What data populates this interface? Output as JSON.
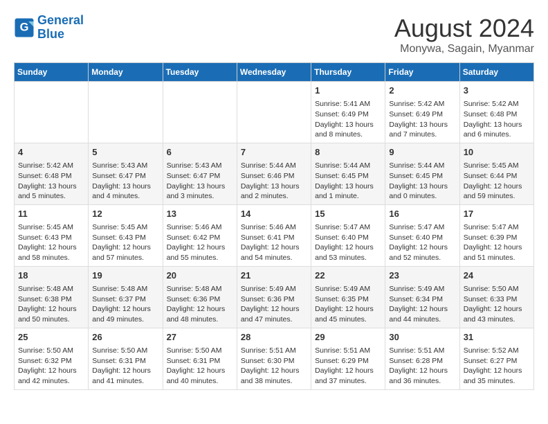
{
  "logo": {
    "line1": "General",
    "line2": "Blue"
  },
  "title": "August 2024",
  "subtitle": "Monywa, Sagain, Myanmar",
  "days_of_week": [
    "Sunday",
    "Monday",
    "Tuesday",
    "Wednesday",
    "Thursday",
    "Friday",
    "Saturday"
  ],
  "weeks": [
    [
      {
        "day": "",
        "content": ""
      },
      {
        "day": "",
        "content": ""
      },
      {
        "day": "",
        "content": ""
      },
      {
        "day": "",
        "content": ""
      },
      {
        "day": "1",
        "content": "Sunrise: 5:41 AM\nSunset: 6:49 PM\nDaylight: 13 hours\nand 8 minutes."
      },
      {
        "day": "2",
        "content": "Sunrise: 5:42 AM\nSunset: 6:49 PM\nDaylight: 13 hours\nand 7 minutes."
      },
      {
        "day": "3",
        "content": "Sunrise: 5:42 AM\nSunset: 6:48 PM\nDaylight: 13 hours\nand 6 minutes."
      }
    ],
    [
      {
        "day": "4",
        "content": "Sunrise: 5:42 AM\nSunset: 6:48 PM\nDaylight: 13 hours\nand 5 minutes."
      },
      {
        "day": "5",
        "content": "Sunrise: 5:43 AM\nSunset: 6:47 PM\nDaylight: 13 hours\nand 4 minutes."
      },
      {
        "day": "6",
        "content": "Sunrise: 5:43 AM\nSunset: 6:47 PM\nDaylight: 13 hours\nand 3 minutes."
      },
      {
        "day": "7",
        "content": "Sunrise: 5:44 AM\nSunset: 6:46 PM\nDaylight: 13 hours\nand 2 minutes."
      },
      {
        "day": "8",
        "content": "Sunrise: 5:44 AM\nSunset: 6:45 PM\nDaylight: 13 hours\nand 1 minute."
      },
      {
        "day": "9",
        "content": "Sunrise: 5:44 AM\nSunset: 6:45 PM\nDaylight: 13 hours\nand 0 minutes."
      },
      {
        "day": "10",
        "content": "Sunrise: 5:45 AM\nSunset: 6:44 PM\nDaylight: 12 hours\nand 59 minutes."
      }
    ],
    [
      {
        "day": "11",
        "content": "Sunrise: 5:45 AM\nSunset: 6:43 PM\nDaylight: 12 hours\nand 58 minutes."
      },
      {
        "day": "12",
        "content": "Sunrise: 5:45 AM\nSunset: 6:43 PM\nDaylight: 12 hours\nand 57 minutes."
      },
      {
        "day": "13",
        "content": "Sunrise: 5:46 AM\nSunset: 6:42 PM\nDaylight: 12 hours\nand 55 minutes."
      },
      {
        "day": "14",
        "content": "Sunrise: 5:46 AM\nSunset: 6:41 PM\nDaylight: 12 hours\nand 54 minutes."
      },
      {
        "day": "15",
        "content": "Sunrise: 5:47 AM\nSunset: 6:40 PM\nDaylight: 12 hours\nand 53 minutes."
      },
      {
        "day": "16",
        "content": "Sunrise: 5:47 AM\nSunset: 6:40 PM\nDaylight: 12 hours\nand 52 minutes."
      },
      {
        "day": "17",
        "content": "Sunrise: 5:47 AM\nSunset: 6:39 PM\nDaylight: 12 hours\nand 51 minutes."
      }
    ],
    [
      {
        "day": "18",
        "content": "Sunrise: 5:48 AM\nSunset: 6:38 PM\nDaylight: 12 hours\nand 50 minutes."
      },
      {
        "day": "19",
        "content": "Sunrise: 5:48 AM\nSunset: 6:37 PM\nDaylight: 12 hours\nand 49 minutes."
      },
      {
        "day": "20",
        "content": "Sunrise: 5:48 AM\nSunset: 6:36 PM\nDaylight: 12 hours\nand 48 minutes."
      },
      {
        "day": "21",
        "content": "Sunrise: 5:49 AM\nSunset: 6:36 PM\nDaylight: 12 hours\nand 47 minutes."
      },
      {
        "day": "22",
        "content": "Sunrise: 5:49 AM\nSunset: 6:35 PM\nDaylight: 12 hours\nand 45 minutes."
      },
      {
        "day": "23",
        "content": "Sunrise: 5:49 AM\nSunset: 6:34 PM\nDaylight: 12 hours\nand 44 minutes."
      },
      {
        "day": "24",
        "content": "Sunrise: 5:50 AM\nSunset: 6:33 PM\nDaylight: 12 hours\nand 43 minutes."
      }
    ],
    [
      {
        "day": "25",
        "content": "Sunrise: 5:50 AM\nSunset: 6:32 PM\nDaylight: 12 hours\nand 42 minutes."
      },
      {
        "day": "26",
        "content": "Sunrise: 5:50 AM\nSunset: 6:31 PM\nDaylight: 12 hours\nand 41 minutes."
      },
      {
        "day": "27",
        "content": "Sunrise: 5:50 AM\nSunset: 6:31 PM\nDaylight: 12 hours\nand 40 minutes."
      },
      {
        "day": "28",
        "content": "Sunrise: 5:51 AM\nSunset: 6:30 PM\nDaylight: 12 hours\nand 38 minutes."
      },
      {
        "day": "29",
        "content": "Sunrise: 5:51 AM\nSunset: 6:29 PM\nDaylight: 12 hours\nand 37 minutes."
      },
      {
        "day": "30",
        "content": "Sunrise: 5:51 AM\nSunset: 6:28 PM\nDaylight: 12 hours\nand 36 minutes."
      },
      {
        "day": "31",
        "content": "Sunrise: 5:52 AM\nSunset: 6:27 PM\nDaylight: 12 hours\nand 35 minutes."
      }
    ]
  ]
}
